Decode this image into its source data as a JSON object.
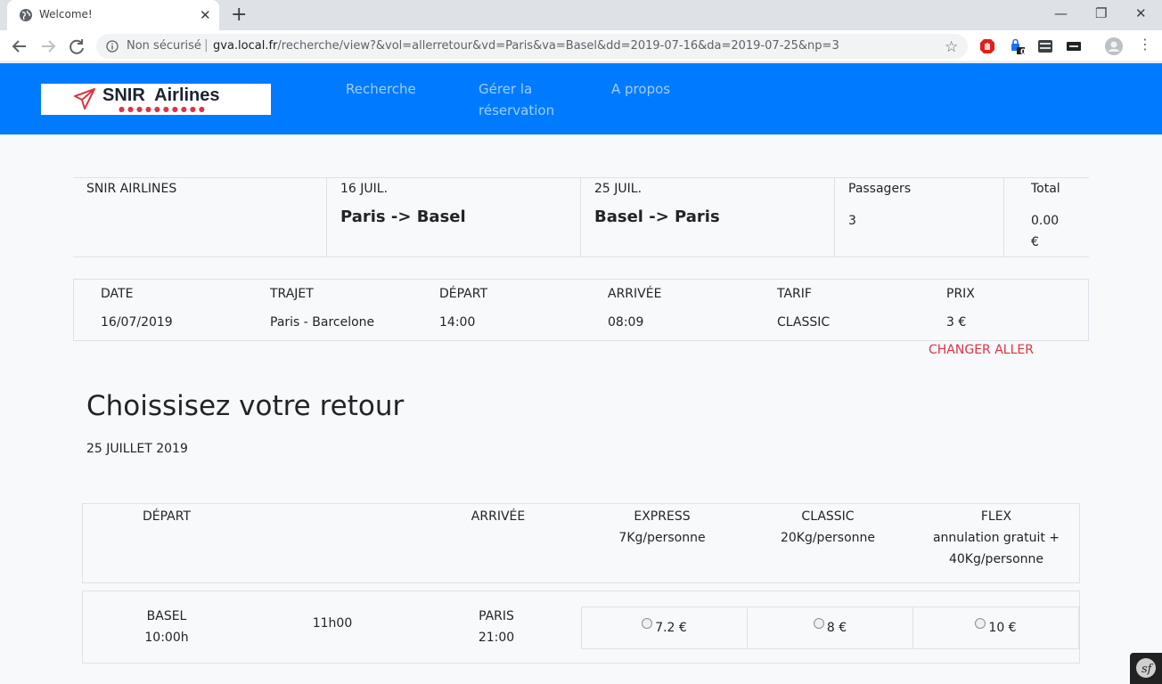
{
  "browser": {
    "tab_title": "Welcome!",
    "not_secure": "Non sécurisé",
    "url_host": "gva.local.fr",
    "url_path": "/recherche/view?&vol=allerretour&vd=Paris&va=Basel&dd=2019-07-16&da=2019-07-25&np=3",
    "extension_badge": "0"
  },
  "site": {
    "brand_name": "SNIR  Airlines",
    "brand_color": "#007bff",
    "nav": {
      "search": "Recherche",
      "manage_line1": "Gérer la",
      "manage_line2": "réservation",
      "about": "A propos"
    }
  },
  "summary": {
    "company": "SNIR AIRLINES",
    "outbound_date": "16 JUIL.",
    "outbound_route": "Paris -> Basel",
    "return_date": "25 JUIL.",
    "return_route": "Basel -> Paris",
    "passengers_label": "Passagers",
    "passengers_value": "3",
    "total_label": "Total",
    "total_amount": "0.00",
    "total_currency": "€"
  },
  "outbound": {
    "headers": {
      "date": "DATE",
      "route": "TRAJET",
      "departure": "DÉPART",
      "arrival": "ARRIVÉE",
      "fare": "TARIF",
      "price": "PRIX"
    },
    "values": {
      "date": "16/07/2019",
      "route": "Paris - Barcelone",
      "departure": "14:00",
      "arrival": "08:09",
      "fare": "CLASSIC",
      "price": "3 €"
    },
    "change_link": "CHANGER ALLER"
  },
  "return_section": {
    "title": "Choissisez votre retour",
    "date": "25 JUILLET 2019",
    "headers": {
      "departure": "DÉPART",
      "arrival": "ARRIVÉE",
      "express": "EXPRESS",
      "express_desc": "7Kg/personne",
      "classic": "CLASSIC",
      "classic_desc": "20Kg/personne",
      "flex": "FLEX",
      "flex_desc1": "annulation gratuit +",
      "flex_desc2": "40Kg/personne"
    },
    "flight": {
      "dep_city": "BASEL",
      "dep_time": "10:00h",
      "duration": "11h00",
      "arr_city": "PARIS",
      "arr_time": "21:00",
      "express_price": "7.2 €",
      "classic_price": "8 €",
      "flex_price": "10 €"
    }
  }
}
